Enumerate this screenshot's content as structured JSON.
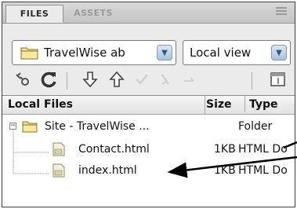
{
  "tabs": [
    {
      "label": "FILES",
      "active": true
    },
    {
      "label": "ASSETS",
      "active": false
    }
  ],
  "site_select": {
    "value": "TravelWise ab"
  },
  "view_select": {
    "value": "Local view"
  },
  "toolbar": {
    "icons": [
      "connect-icon",
      "refresh-icon",
      "get-files-icon",
      "put-files-icon",
      "check-out-icon",
      "check-in-icon",
      "sync-icon",
      "expand-icon"
    ]
  },
  "list": {
    "headers": {
      "name": "Local Files",
      "size": "Size",
      "type": "Type"
    },
    "rows": [
      {
        "name": "Site - TravelWise ...",
        "size": "",
        "type": "Folder",
        "kind": "folder"
      },
      {
        "name": "Contact.html",
        "size": "1KB",
        "type": "HTML Do",
        "kind": "file"
      },
      {
        "name": "index.html",
        "size": "1KB",
        "type": "HTML Do",
        "kind": "file"
      }
    ]
  },
  "colors": {
    "panel_bg": "#ebebeb",
    "folder_fill": "#f2e08a",
    "arrow_blue": "#a8c2de",
    "annotation": "#000000"
  }
}
